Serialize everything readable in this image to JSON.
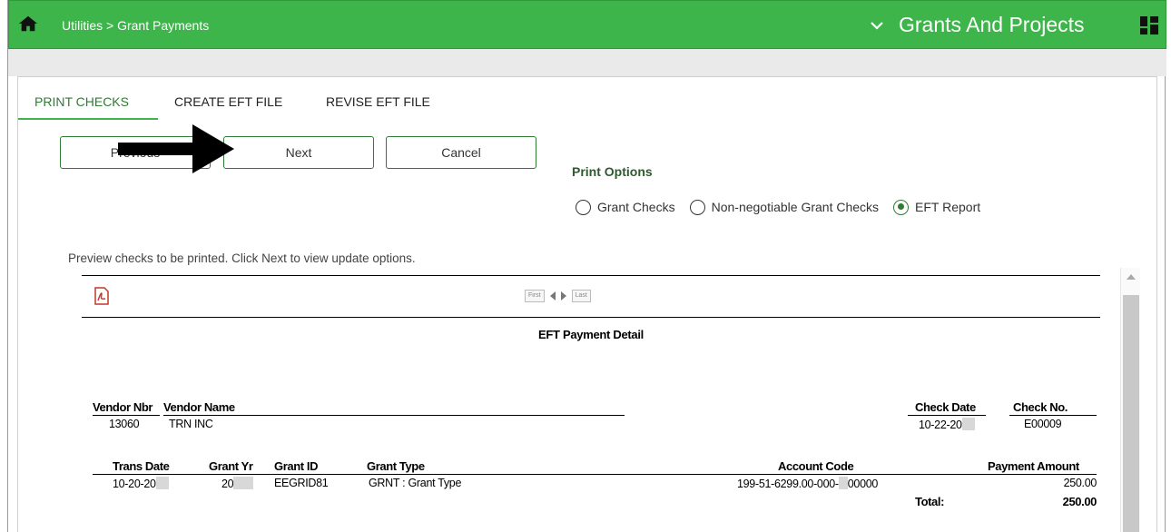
{
  "header": {
    "breadcrumb": "Utilities > Grant Payments",
    "app_title": "Grants And Projects",
    "bar_color": "#3db54a"
  },
  "tabs": [
    {
      "label": "PRINT CHECKS",
      "active": true
    },
    {
      "label": "CREATE EFT FILE",
      "active": false
    },
    {
      "label": "REVISE EFT FILE",
      "active": false
    }
  ],
  "buttons": {
    "previous": "Previous",
    "next": "Next",
    "cancel": "Cancel"
  },
  "print_options": {
    "label": "Print Options",
    "options": [
      {
        "label": "Grant Checks",
        "selected": false
      },
      {
        "label": "Non-negotiable Grant Checks",
        "selected": false
      },
      {
        "label": "EFT Report",
        "selected": true
      }
    ]
  },
  "preview_note": "Preview checks to be printed. Click Next to view update options.",
  "report": {
    "pager": {
      "first": "First",
      "last": "Last"
    },
    "title": "EFT Payment Detail",
    "vendor_headers": {
      "vendor_nbr": "Vendor Nbr",
      "vendor_name": "Vendor Name",
      "check_date": "Check Date",
      "check_no": "Check No."
    },
    "vendor_row": {
      "vendor_nbr": "13060",
      "vendor_name": "TRN INC",
      "check_date": "10-22-20",
      "check_no": "E00009"
    },
    "detail_headers": {
      "trans_date": "Trans Date",
      "grant_yr": "Grant Yr",
      "grant_id": "Grant ID",
      "grant_type": "Grant Type",
      "account_code": "Account Code",
      "payment_amount": "Payment Amount"
    },
    "detail_row": {
      "trans_date": "10-20-20",
      "grant_yr": "20",
      "grant_id": "EEGRID81",
      "grant_type": "GRNT : Grant Type",
      "account_code_prefix": "199-51-6299.00-000-",
      "account_code_suffix": "00000",
      "payment_amount": "250.00"
    },
    "total_label": "Total:",
    "total_value": "250.00"
  }
}
